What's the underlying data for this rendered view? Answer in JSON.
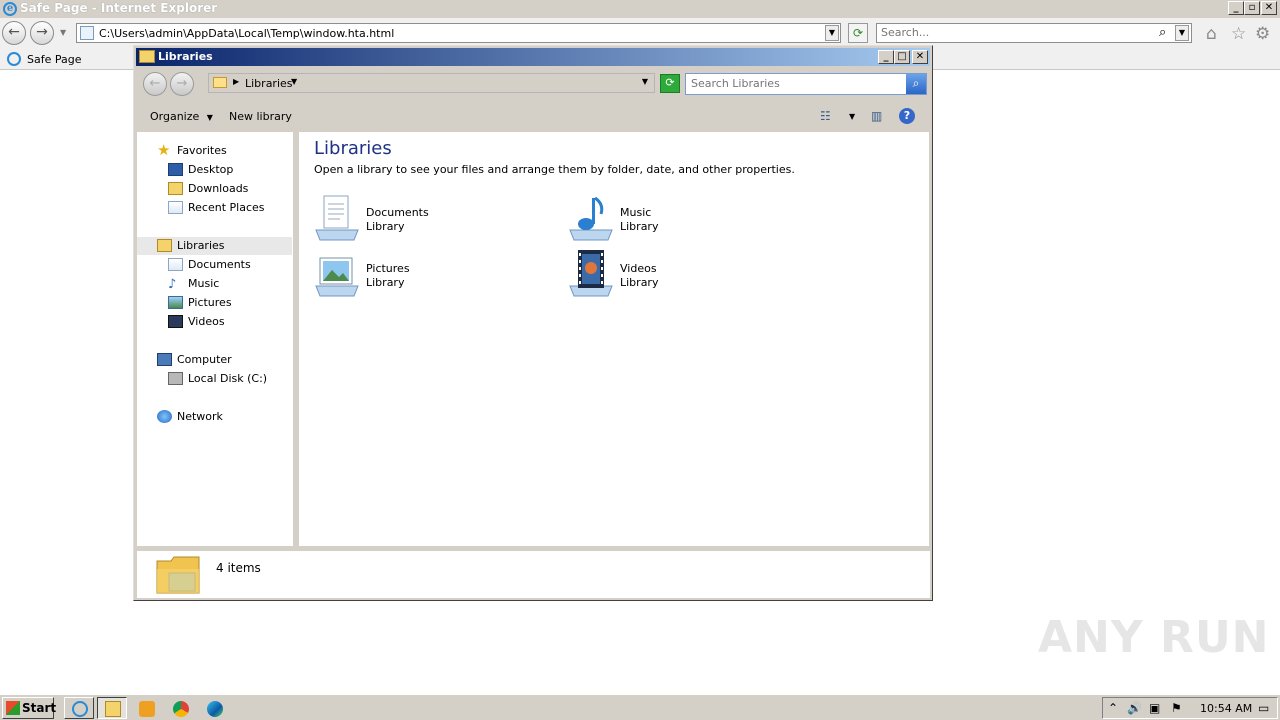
{
  "ie": {
    "title": "Safe Page - Internet Explorer",
    "address": "C:\\Users\\admin\\AppData\\Local\\Temp\\window.hta.html",
    "search_placeholder": "Search...",
    "tab_label": "Safe Page"
  },
  "explorer": {
    "title": "Libraries",
    "breadcrumb": "Libraries",
    "search_placeholder": "Search Libraries",
    "toolbar": {
      "organize": "Organize",
      "new_library": "New library"
    },
    "nav": {
      "favorites": "Favorites",
      "desktop": "Desktop",
      "downloads": "Downloads",
      "recent_places": "Recent Places",
      "libraries": "Libraries",
      "documents": "Documents",
      "music": "Music",
      "pictures": "Pictures",
      "videos": "Videos",
      "computer": "Computer",
      "local_disk": "Local Disk (C:)",
      "network": "Network"
    },
    "main": {
      "heading": "Libraries",
      "description": "Open a library to see your files and arrange them by folder, date, and other properties.",
      "libraries": [
        {
          "name": "Documents",
          "type": "Library",
          "icon": "documents-library-icon"
        },
        {
          "name": "Music",
          "type": "Library",
          "icon": "music-library-icon"
        },
        {
          "name": "Pictures",
          "type": "Library",
          "icon": "pictures-library-icon"
        },
        {
          "name": "Videos",
          "type": "Library",
          "icon": "videos-library-icon"
        }
      ]
    },
    "status": {
      "item_count": "4 items"
    }
  },
  "taskbar": {
    "start_label": "Start",
    "clock": "10:54 AM"
  },
  "watermark": "ANY RUN"
}
